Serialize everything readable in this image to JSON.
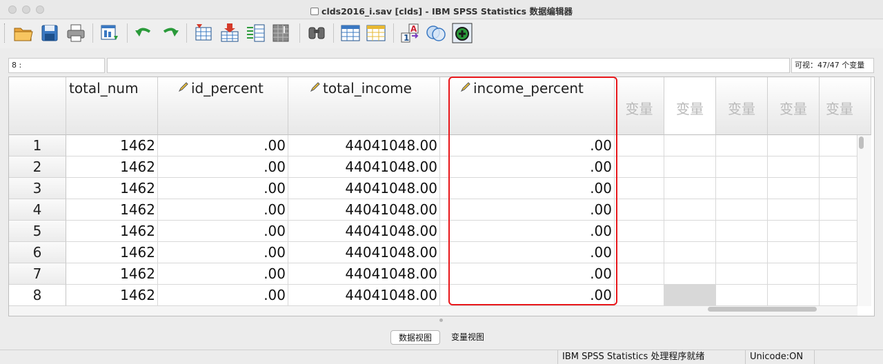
{
  "window": {
    "title": "clds2016_i.sav [clds] - IBM SPSS Statistics 数据编辑器"
  },
  "toolbar": {
    "buttons": [
      {
        "name": "open-icon",
        "label": "打开"
      },
      {
        "name": "save-icon",
        "label": "保存"
      },
      {
        "name": "print-icon",
        "label": "打印"
      },
      {
        "name": "dialog-recall-icon",
        "label": "对话框调用"
      },
      {
        "name": "undo-icon",
        "label": "撤销"
      },
      {
        "name": "redo-icon",
        "label": "重做"
      },
      {
        "name": "goto-case-icon",
        "label": "转至个案"
      },
      {
        "name": "goto-variable-icon",
        "label": "转至变量"
      },
      {
        "name": "variables-icon",
        "label": "变量"
      },
      {
        "name": "run-descriptives-icon",
        "label": "描述统计"
      },
      {
        "name": "find-icon",
        "label": "查找"
      },
      {
        "name": "insert-cases-icon",
        "label": "插入个案"
      },
      {
        "name": "insert-variable-icon",
        "label": "插入变量"
      },
      {
        "name": "value-labels-icon",
        "label": "值标签"
      },
      {
        "name": "use-sets-icon",
        "label": "使用变量集"
      },
      {
        "name": "show-all-variables-icon",
        "label": "显示所有变量"
      }
    ]
  },
  "refbar": {
    "cell_ref": "8 :",
    "cell_value": "",
    "visible_vars": "可视：47/47 个变量"
  },
  "grid": {
    "columns": [
      {
        "name": "total_num",
        "scale": false
      },
      {
        "name": "id_percent",
        "scale": true
      },
      {
        "name": "total_income",
        "scale": true
      },
      {
        "name": "income_percent",
        "scale": true
      }
    ],
    "empty_column_label": "变量",
    "rows": [
      {
        "id": "1",
        "cells": [
          "1462",
          ".00",
          "44041048.00",
          ".00"
        ]
      },
      {
        "id": "2",
        "cells": [
          "1462",
          ".00",
          "44041048.00",
          ".00"
        ]
      },
      {
        "id": "3",
        "cells": [
          "1462",
          ".00",
          "44041048.00",
          ".00"
        ]
      },
      {
        "id": "4",
        "cells": [
          "1462",
          ".00",
          "44041048.00",
          ".00"
        ]
      },
      {
        "id": "5",
        "cells": [
          "1462",
          ".00",
          "44041048.00",
          ".00"
        ]
      },
      {
        "id": "6",
        "cells": [
          "1462",
          ".00",
          "44041048.00",
          ".00"
        ]
      },
      {
        "id": "7",
        "cells": [
          "1462",
          ".00",
          "44041048.00",
          ".00"
        ]
      },
      {
        "id": "8",
        "cells": [
          "1462",
          ".00",
          "44041048.00",
          ".00"
        ]
      }
    ]
  },
  "tabs": {
    "data_view": "数据视图",
    "variable_view": "变量视图"
  },
  "status": {
    "processor": "IBM SPSS Statistics 处理程序就绪",
    "unicode": "Unicode:ON"
  },
  "colors": {
    "highlight_box": "#e8161a",
    "grid_line": "#d8d8d8"
  }
}
